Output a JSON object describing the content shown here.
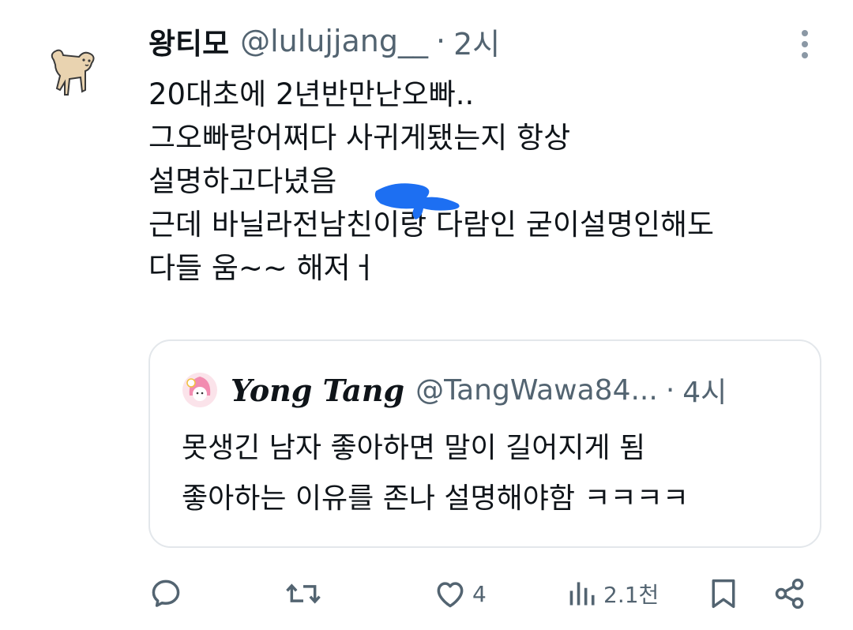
{
  "tweet": {
    "author_name": "왕티모",
    "author_handle": "@lulujjang__",
    "separator": "·",
    "time": "2시",
    "lines": [
      "20대초에 2년반만난오빠..",
      "그오빠랑어쩌다 사귀게됐는지 항상",
      "설명하고다녔음",
      "근데 바닐라전남친이랑 다람인 굳이설명인해도",
      "다들 움~~ 해저ㅓ"
    ]
  },
  "quote": {
    "author_name": "Yong Tang",
    "author_handle": "@TangWawa84...",
    "separator": "·",
    "time": "4시",
    "lines": [
      "못생긴 남자 좋아하면 말이 길어지게 됨",
      "좋아하는 이유를 존나 설명해야함 ㅋㅋㅋㅋ"
    ]
  },
  "actions": {
    "reply_icon": "reply-icon",
    "retweet_icon": "retweet-icon",
    "like_icon": "heart-icon",
    "like_count": "4",
    "views_icon": "views-icon",
    "views_count": "2.1천",
    "bookmark_icon": "bookmark-icon",
    "share_icon": "share-icon"
  },
  "colors": {
    "text": "#0f1419",
    "secondary": "#536471",
    "border": "#e3e7eb",
    "scribble": "#1d6ff2"
  }
}
